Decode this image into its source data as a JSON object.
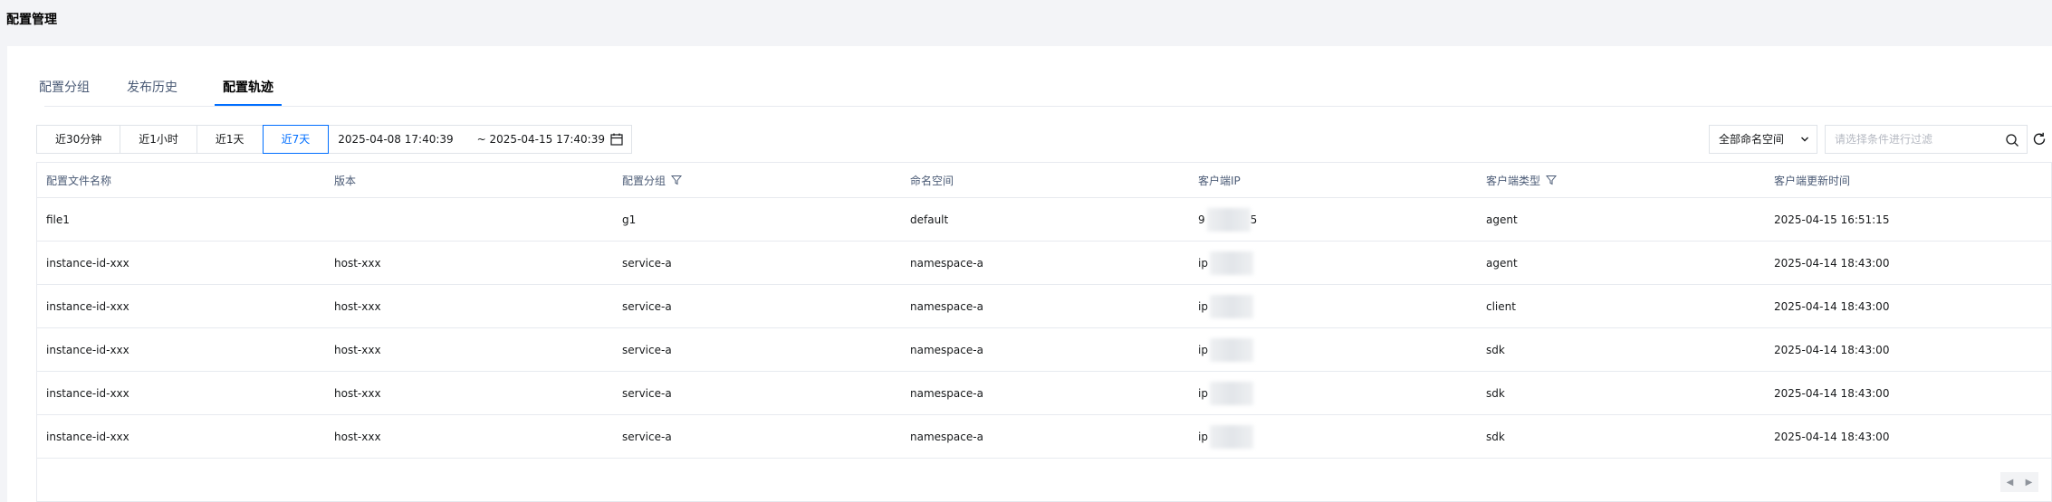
{
  "page": {
    "title": "配置管理"
  },
  "tabs": [
    {
      "label": "配置分组",
      "active": false
    },
    {
      "label": "发布历史",
      "active": false
    },
    {
      "label": "配置轨迹",
      "active": true
    }
  ],
  "time_range": {
    "options": [
      "近30分钟",
      "近1小时",
      "近1天",
      "近7天"
    ],
    "active": "近7天",
    "start": "2025-04-08 17:40:39",
    "end": "~ 2025-04-15 17:40:39"
  },
  "filters": {
    "namespace_select": "全部命名空间",
    "search_placeholder": "请选择条件进行过滤"
  },
  "table": {
    "columns": [
      "配置文件名称",
      "版本",
      "配置分组",
      "命名空间",
      "客户端IP",
      "客户端类型",
      "客户端更新时间"
    ],
    "rows": [
      {
        "file": "file1",
        "version": "",
        "group": "g1",
        "namespace": "default",
        "ip_prefix": "9",
        "ip_suffix": "5",
        "type": "agent",
        "updated": "2025-04-15 16:51:15"
      },
      {
        "file": "instance-id-xxx",
        "version": "host-xxx",
        "group": "service-a",
        "namespace": "namespace-a",
        "ip_prefix": "ip",
        "ip_suffix": "",
        "type": "agent",
        "updated": "2025-04-14 18:43:00"
      },
      {
        "file": "instance-id-xxx",
        "version": "host-xxx",
        "group": "service-a",
        "namespace": "namespace-a",
        "ip_prefix": "ip",
        "ip_suffix": "",
        "type": "client",
        "updated": "2025-04-14 18:43:00"
      },
      {
        "file": "instance-id-xxx",
        "version": "host-xxx",
        "group": "service-a",
        "namespace": "namespace-a",
        "ip_prefix": "ip",
        "ip_suffix": "",
        "type": "sdk",
        "updated": "2025-04-14 18:43:00"
      },
      {
        "file": "instance-id-xxx",
        "version": "host-xxx",
        "group": "service-a",
        "namespace": "namespace-a",
        "ip_prefix": "ip",
        "ip_suffix": "",
        "type": "sdk",
        "updated": "2025-04-14 18:43:00"
      },
      {
        "file": "instance-id-xxx",
        "version": "host-xxx",
        "group": "service-a",
        "namespace": "namespace-a",
        "ip_prefix": "ip",
        "ip_suffix": "",
        "type": "sdk",
        "updated": "2025-04-14 18:43:00"
      }
    ]
  },
  "colors": {
    "accent": "#006eff",
    "border": "#e7eaef",
    "background": "#f3f4f7"
  }
}
